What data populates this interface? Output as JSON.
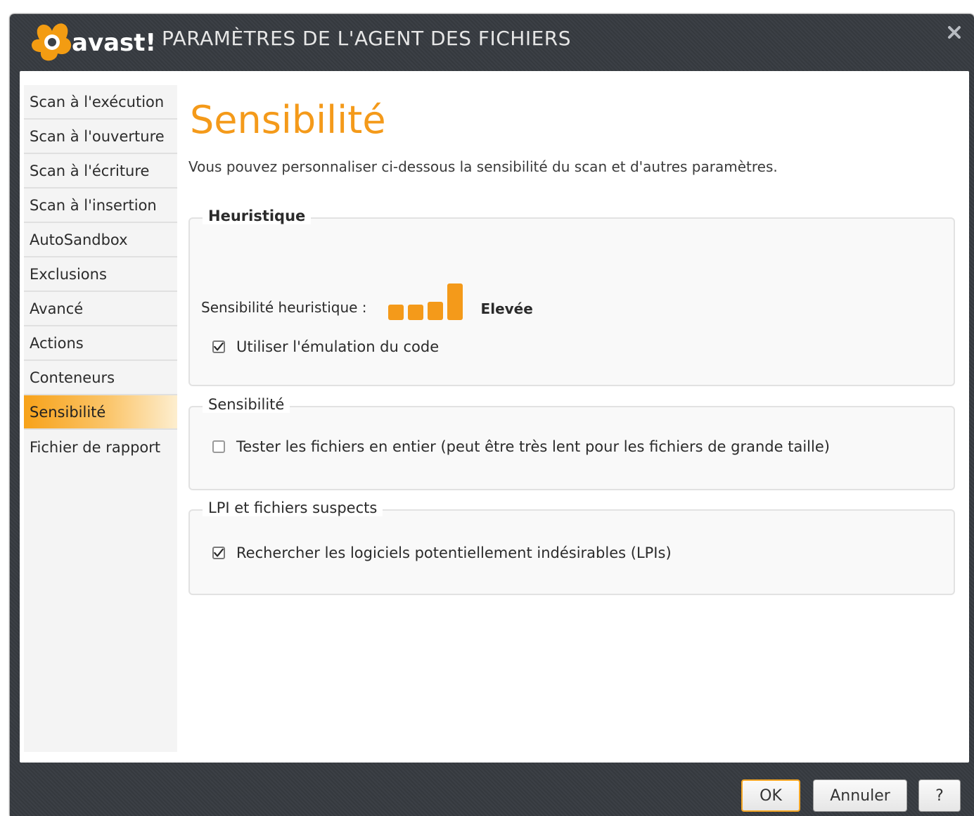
{
  "window": {
    "title": "PARAMÈTRES DE L'AGENT DES FICHIERS",
    "logo_text": "avast!",
    "close_icon": "close-icon"
  },
  "sidebar": {
    "items": [
      {
        "label": "Scan à l'exécution"
      },
      {
        "label": "Scan à l'ouverture"
      },
      {
        "label": "Scan à l'écriture"
      },
      {
        "label": "Scan à l'insertion"
      },
      {
        "label": "AutoSandbox"
      },
      {
        "label": "Exclusions"
      },
      {
        "label": "Avancé"
      },
      {
        "label": "Actions"
      },
      {
        "label": "Conteneurs"
      },
      {
        "label": "Sensibilité"
      },
      {
        "label": "Fichier de rapport"
      }
    ],
    "active_index": 9
  },
  "main": {
    "title": "Sensibilité",
    "subtitle": "Vous pouvez personnaliser ci-dessous la sensibilité du scan et d'autres paramètres.",
    "heuristique": {
      "legend": "Heuristique",
      "sensitivity_label": "Sensibilité heuristique :",
      "level_text": "Elevée",
      "level_value": 4,
      "level_max": 4,
      "emulation_label": "Utiliser l'émulation du code",
      "emulation_checked": true
    },
    "sensibilite": {
      "legend": "Sensibilité",
      "full_files_label": "Tester les fichiers en entier (peut être très lent pour les fichiers de grande taille)",
      "full_files_checked": false
    },
    "lpi": {
      "legend": "LPI et fichiers suspects",
      "lpi_label": "Rechercher les logiciels potentiellement indésirables (LPIs)",
      "lpi_checked": true
    }
  },
  "footer": {
    "ok_label": "OK",
    "cancel_label": "Annuler",
    "help_label": "?"
  },
  "colors": {
    "accent": "#f49a1a",
    "title_bar": "#3c4046"
  }
}
